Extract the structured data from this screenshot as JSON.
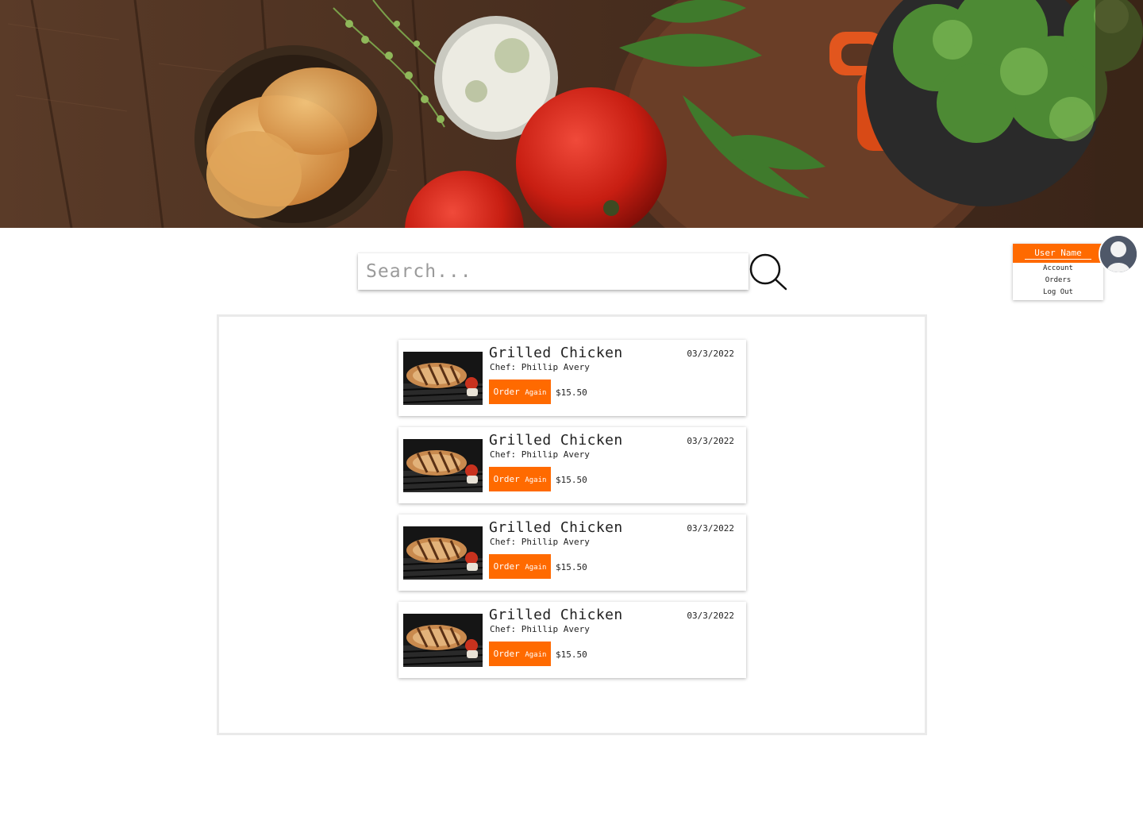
{
  "search": {
    "placeholder": "Search..."
  },
  "user_menu": {
    "user_name": "User Name",
    "items": [
      "Account",
      "Orders",
      "Log Out"
    ]
  },
  "orders": [
    {
      "title": "Grilled Chicken",
      "chef": "Chef: Phillip Avery",
      "date": "03/3/2022",
      "button_label_1": "Order",
      "button_label_2": "Again",
      "price": "$15.50"
    },
    {
      "title": "Grilled Chicken",
      "chef": "Chef: Phillip Avery",
      "date": "03/3/2022",
      "button_label_1": "Order",
      "button_label_2": "Again",
      "price": "$15.50"
    },
    {
      "title": "Grilled Chicken",
      "chef": "Chef: Phillip Avery",
      "date": "03/3/2022",
      "button_label_1": "Order",
      "button_label_2": "Again",
      "price": "$15.50"
    },
    {
      "title": "Grilled Chicken",
      "chef": "Chef: Phillip Avery",
      "date": "03/3/2022",
      "button_label_1": "Order",
      "button_label_2": "Again",
      "price": "$15.50"
    }
  ],
  "colors": {
    "accent": "#ff6a00",
    "panel_border": "#eaeaea"
  },
  "icons": {
    "search": "search-icon",
    "avatar": "user-avatar-icon"
  }
}
